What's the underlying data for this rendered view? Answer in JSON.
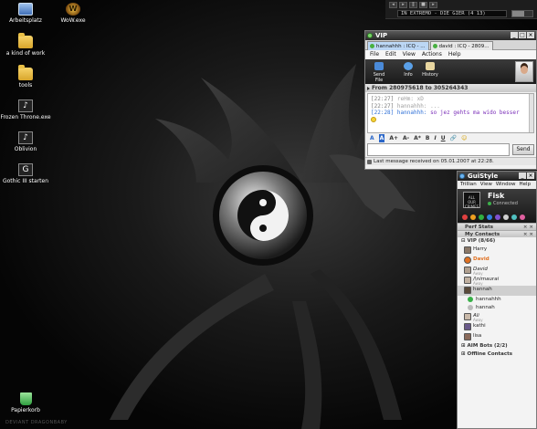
{
  "desktop": {
    "icons": [
      {
        "label": "Arbeitsplatz",
        "icon": "computer-icon"
      },
      {
        "label": "WoW.exe",
        "icon": "wow-icon"
      },
      {
        "label": "a kind of work",
        "icon": "folder-icon"
      },
      {
        "label": "tools",
        "icon": "folder-icon"
      },
      {
        "label": "Frozen Throne.exe",
        "icon": "game-icon"
      },
      {
        "label": "Oblivion",
        "icon": "game-icon"
      },
      {
        "label": "Gothic III starten",
        "icon": "game-icon"
      },
      {
        "label": "Papierkorb",
        "icon": "recycle-bin-icon"
      }
    ],
    "wallpaper_symbol": "yin-yang-icon"
  },
  "media_player": {
    "track": "IN EXTREMO - DIE GIER (4 13)",
    "volume_fraction": 0.6
  },
  "vip_window": {
    "title": "VIP",
    "tabs": [
      {
        "label": "hannahhh : ICQ - ..."
      },
      {
        "label": "david : ICQ - 2809..."
      }
    ],
    "menu": [
      "File",
      "Edit",
      "View",
      "Actions",
      "Help"
    ],
    "toolbar": [
      {
        "label": "Send File",
        "icon": "send-file-icon"
      },
      {
        "label": "Info",
        "icon": "info-icon"
      },
      {
        "label": "History",
        "icon": "history-icon"
      }
    ],
    "route": "From 280975618 to 305264343",
    "messages": [
      {
        "time": "[22:27]",
        "name": "reHm:",
        "text": "xD",
        "own": false
      },
      {
        "time": "[22:27]",
        "name": "hannahhh:",
        "text": "...",
        "own": false
      },
      {
        "time": "[22:28]",
        "name": "hannahhh:",
        "text": "so jez gehts ma wido besser",
        "own": true
      }
    ],
    "format_buttons": [
      "A",
      "A",
      "A+",
      "A-",
      "A*",
      "B",
      "I",
      "U"
    ],
    "send_label": "Send",
    "status": "Last message received on 05.01.2007 at 22:28."
  },
  "contact_list": {
    "title": "GuiStyle",
    "menu": [
      "Trillian",
      "View",
      "Window",
      "Help"
    ],
    "profile": {
      "name": "Fisk",
      "status": "Connected",
      "frame_text": "ALL OUR CRIMES"
    },
    "section_perf": "Perf Stats",
    "section_contacts": "My Contacts",
    "group_vip": "VIP (8/66)",
    "contacts": [
      {
        "name": "Harry",
        "sub": ""
      },
      {
        "name": "David",
        "sub": "",
        "color": "#e07020"
      },
      {
        "name": "David",
        "sub": "Away"
      },
      {
        "name": "/\\nimaurai",
        "sub": "Away"
      },
      {
        "name": "hannah",
        "sub": "",
        "selected": true
      },
      {
        "name": "hannahhh",
        "sub": "",
        "child": true
      },
      {
        "name": "hannah",
        "sub": "",
        "child": true
      },
      {
        "name": "Ali",
        "sub": "Away"
      },
      {
        "name": "kathi",
        "sub": ""
      },
      {
        "name": "lisa",
        "sub": ""
      }
    ],
    "group_aim": "AIM Bots (2/2)",
    "group_offline": "Offline Contacts"
  },
  "watermark": "DEVIANT DRAGONBABY"
}
